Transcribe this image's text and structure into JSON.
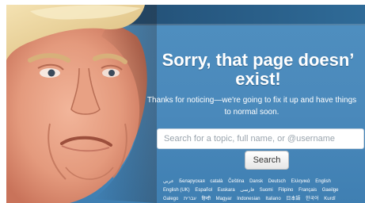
{
  "error": {
    "headline_line1": "Sorry, that page doesn’",
    "headline_line2": "exist!",
    "subtext_line1": "Thanks for noticing—we're going to fix it up and have things",
    "subtext_line2": "to normal soon."
  },
  "search": {
    "placeholder": "Search for a topic, full name, or @username",
    "button_label": "Search"
  },
  "languages": {
    "rows": [
      [
        "عربي",
        "Беларуская",
        "català",
        "Čeština",
        "Dansk",
        "Deutsch",
        "Ελληνικά",
        "English"
      ],
      [
        "English (UK)",
        "Español",
        "Euskara",
        "فارسی",
        "Suomi",
        "Filipino",
        "Français",
        "Gaeilge"
      ],
      [
        "Galego",
        "עברית",
        "हिन्दी",
        "Magyar",
        "Indonesian",
        "Italiano",
        "日本語",
        "한국어",
        "Kurdî"
      ]
    ]
  },
  "colors": {
    "page_background": "#4a89bb",
    "top_band": "#1d3f60",
    "text": "#ffffff"
  },
  "photo": {
    "subject": "portrait-photo"
  }
}
